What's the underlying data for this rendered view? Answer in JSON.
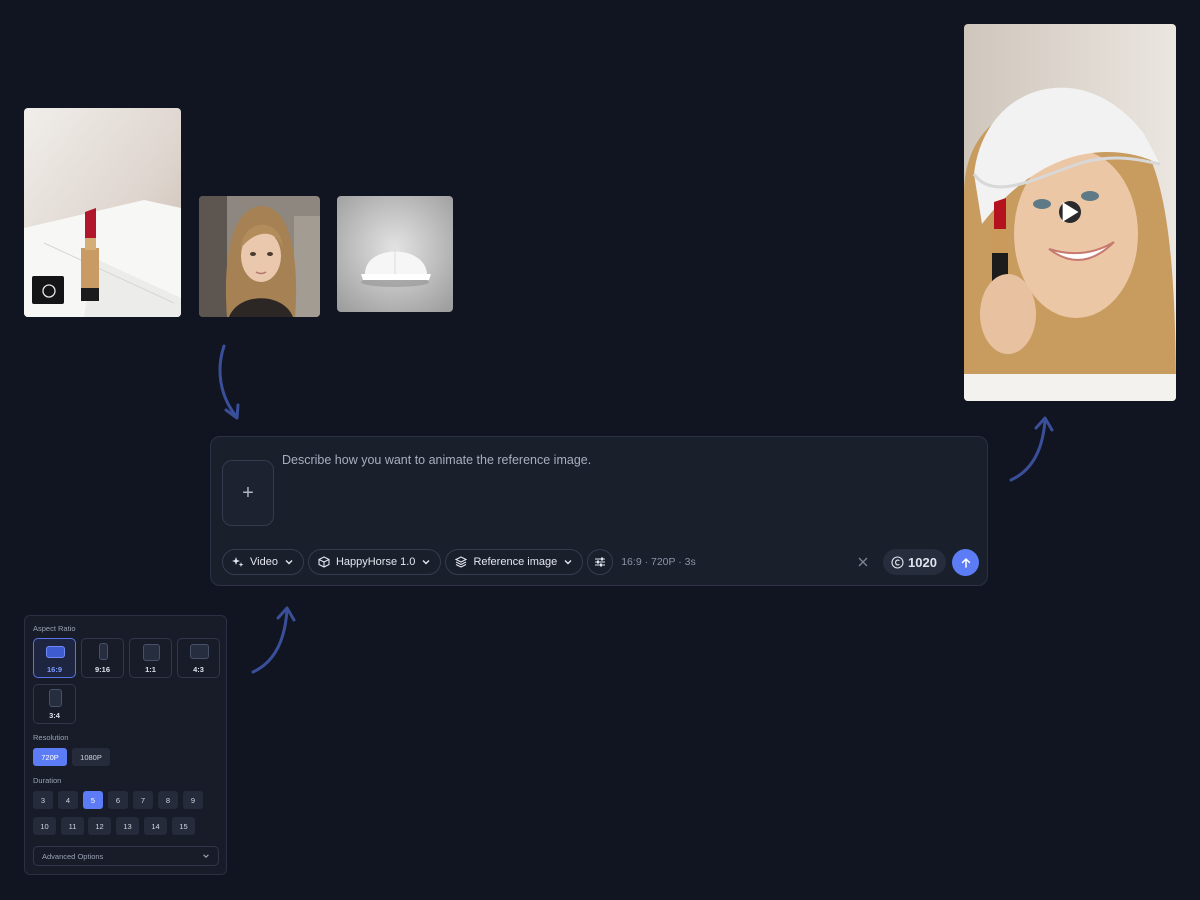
{
  "references": [
    {
      "name": "lipstick-reference-image",
      "icon": "lipstick-photo"
    },
    {
      "name": "woman-portrait-reference-image",
      "icon": "portrait-photo"
    },
    {
      "name": "white-cap-reference-image",
      "icon": "cap-photo"
    }
  ],
  "result": {
    "icon": "play-icon"
  },
  "prompt": {
    "placeholder": "Describe how you want to animate the reference image.",
    "add_icon": "plus-icon",
    "mode_label": "Video",
    "model_label": "HappyHorse 1.0",
    "input_label": "Reference image",
    "summary": "16:9 · 720P · 3s",
    "credits": "1020",
    "credit_icon": "copyright-icon",
    "send_icon": "arrow-up-icon"
  },
  "settings": {
    "aspect_ratio_label": "Aspect Ratio",
    "aspect_ratios": [
      "16:9",
      "9:16",
      "1:1",
      "4:3",
      "3:4"
    ],
    "selected_aspect_ratio": "16:9",
    "resolution_label": "Resolution",
    "resolutions": [
      "720P",
      "1080P"
    ],
    "selected_resolution": "720P",
    "duration_label": "Duration",
    "durations": [
      "3",
      "4",
      "5",
      "6",
      "7",
      "8",
      "9",
      "10",
      "11",
      "12",
      "13",
      "14",
      "15"
    ],
    "selected_duration": "5",
    "advanced_label": "Advanced Options"
  },
  "colors": {
    "background": "#111521",
    "accent": "#5b7cf5",
    "arrow": "#3a4f9a"
  }
}
